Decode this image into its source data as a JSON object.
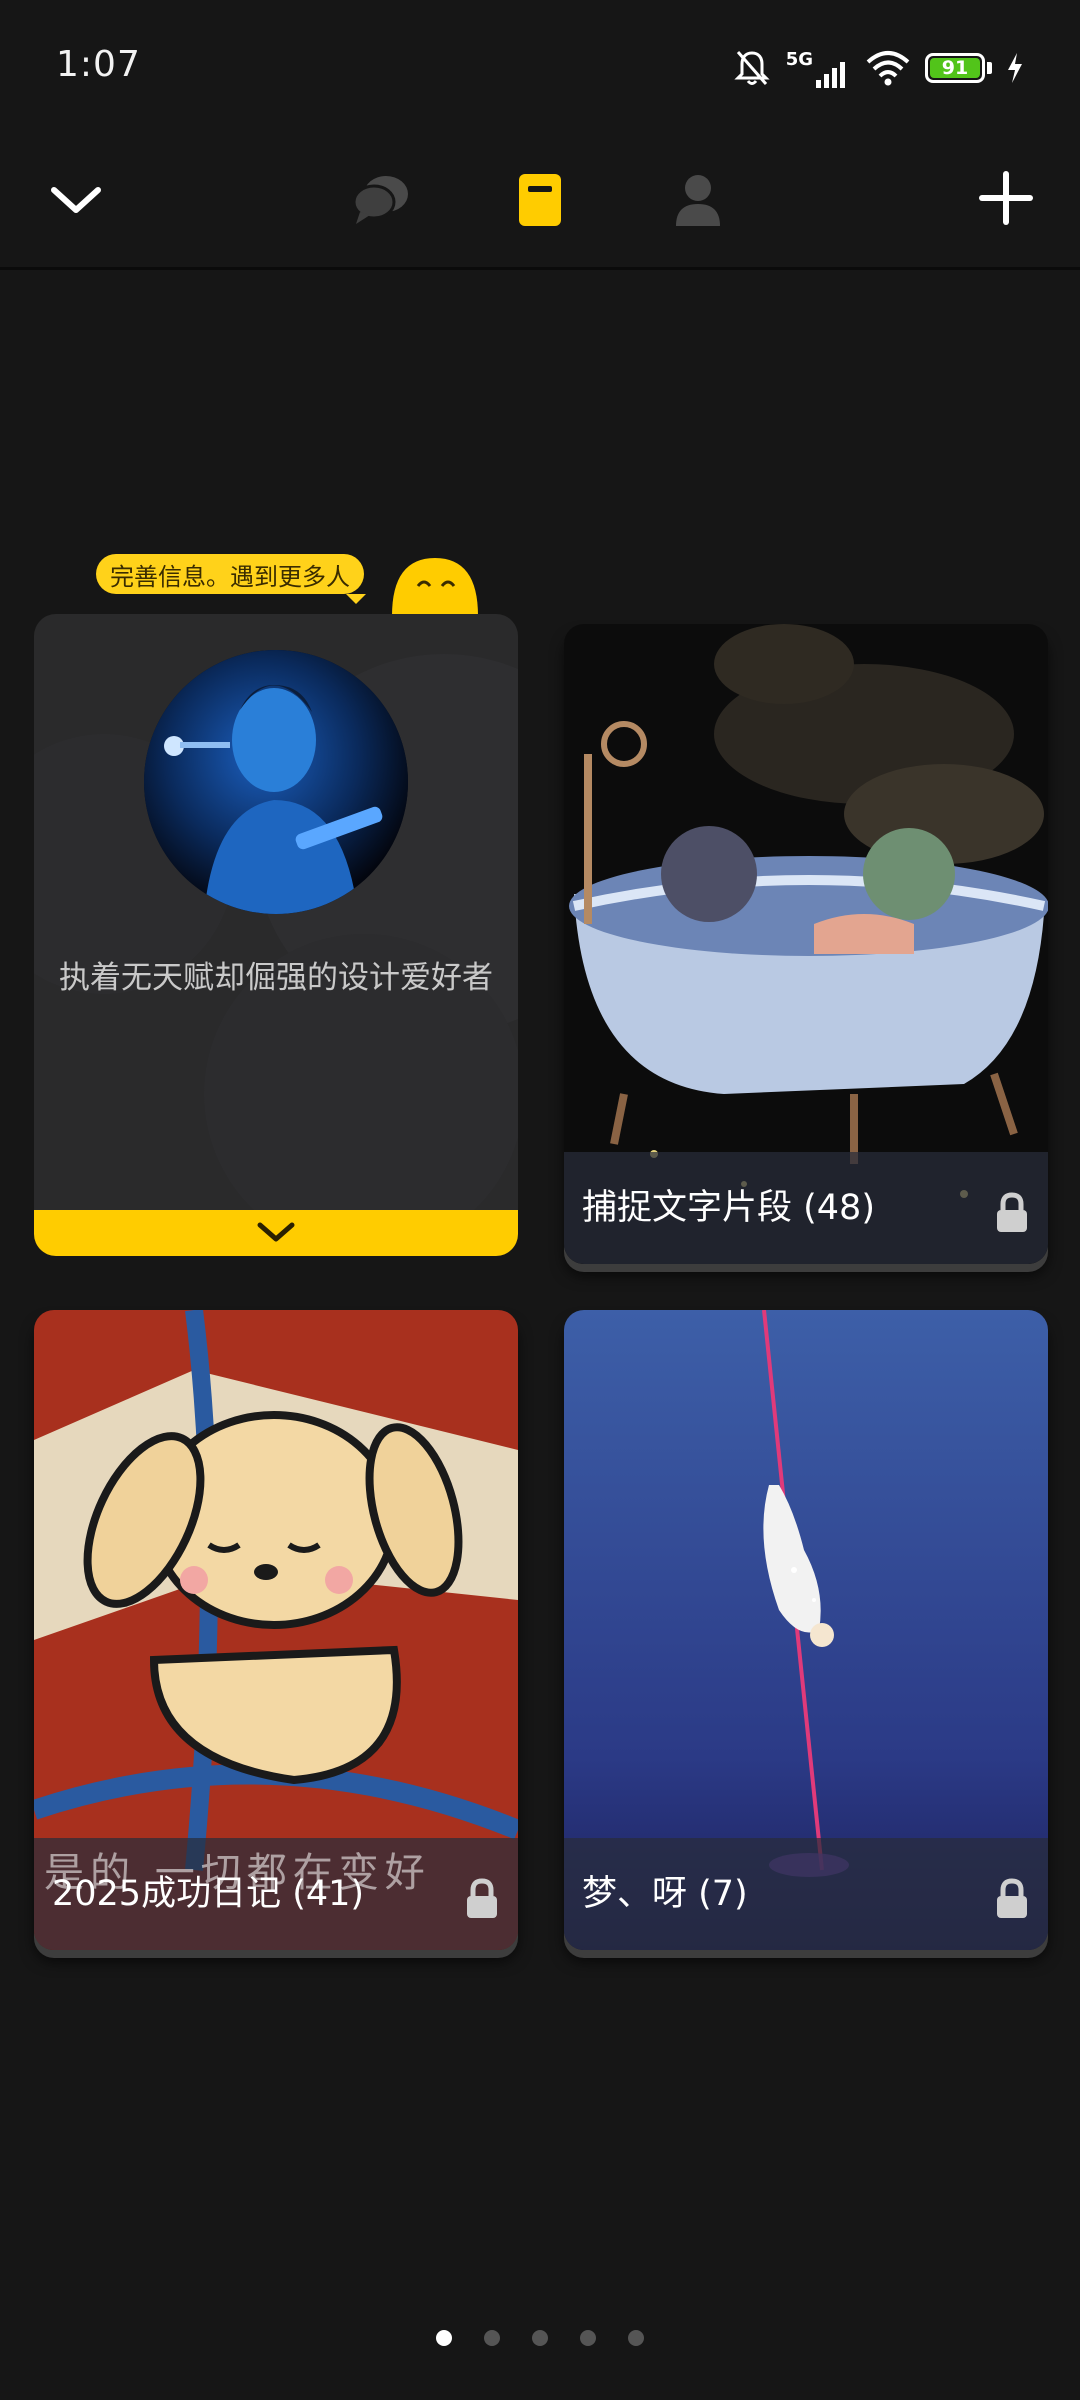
{
  "status": {
    "time": "1:07",
    "network": "5G",
    "battery": "91",
    "battery_level": 0.91,
    "battery_color": "#52c41a"
  },
  "nav": {
    "back_icon": "chevron-down-icon",
    "tabs": [
      {
        "name": "messages",
        "icon": "chat-bubbles-icon",
        "active": false
      },
      {
        "name": "diaries",
        "icon": "notebook-icon",
        "active": true
      },
      {
        "name": "profile",
        "icon": "person-icon",
        "active": false
      }
    ],
    "add_icon": "plus-icon",
    "accent": "#ffcc00"
  },
  "profile": {
    "tip": "完善信息。遇到更多人",
    "bio": "执着无天赋却倔强的设计爱好者"
  },
  "diaries": [
    {
      "title": "捕捉文字片段 (48)",
      "locked": true
    },
    {
      "title": "2025成功日记 (41)",
      "locked": true,
      "cover_text": "是的 一切都在变好"
    },
    {
      "title": "梦、呀 (7)",
      "locked": true
    }
  ],
  "pager": {
    "total": 5,
    "current": 1
  }
}
